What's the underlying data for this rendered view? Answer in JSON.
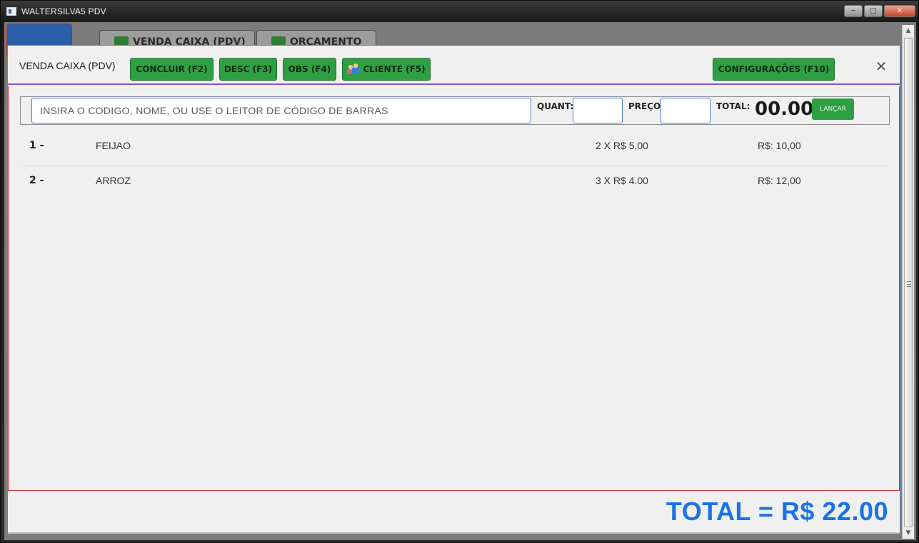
{
  "window": {
    "title": "WALTERSILVA5 PDV",
    "controls": {
      "minimize": "─",
      "maximize": "□",
      "close": "✕"
    }
  },
  "background": {
    "tabs": [
      {
        "label": "VENDA CAIXA (PDV)"
      },
      {
        "label": "ORÇAMENTO"
      }
    ]
  },
  "modal": {
    "title": "VENDA CAIXA (PDV)",
    "buttons": {
      "concluir": "CONCLUIR (F2)",
      "desc": "DESC (F3)",
      "obs": "OBS (F4)",
      "cliente": "CLIENTE (F5)",
      "config": "CONFIGURAÇÕES (F10)"
    },
    "close_symbol": "✕",
    "entry": {
      "code_placeholder": "INSIRA O CODIGO, NOME, OU USE O LEITOR DE CÓDIGO DE BARRAS",
      "quant_label": "QUANT:",
      "preco_label": "PREÇO:",
      "total_label": "TOTAL:",
      "total_value": "00.00",
      "lancar_label": "LANÇAR"
    },
    "items": [
      {
        "num": "1 -",
        "name": "FEIJAO",
        "qty": "2 X R$ 5.00",
        "subtotal": "R$: 10,00"
      },
      {
        "num": "2 -",
        "name": "ARROZ",
        "qty": "3 X R$ 4.00",
        "subtotal": "R$: 12,00"
      }
    ],
    "grand_total": "TOTAL = R$ 22.00"
  },
  "scrollbar": {
    "up": "▲",
    "down": "▼"
  },
  "colors": {
    "accent_green": "#2ea043",
    "total_blue": "#1a73e8",
    "header_border": "#7e57c2",
    "body_border": "#d2333e"
  },
  "icons": {
    "window_icon": "app-window-icon",
    "cliente_icon": "people-icon",
    "close_icon": "close-icon"
  }
}
